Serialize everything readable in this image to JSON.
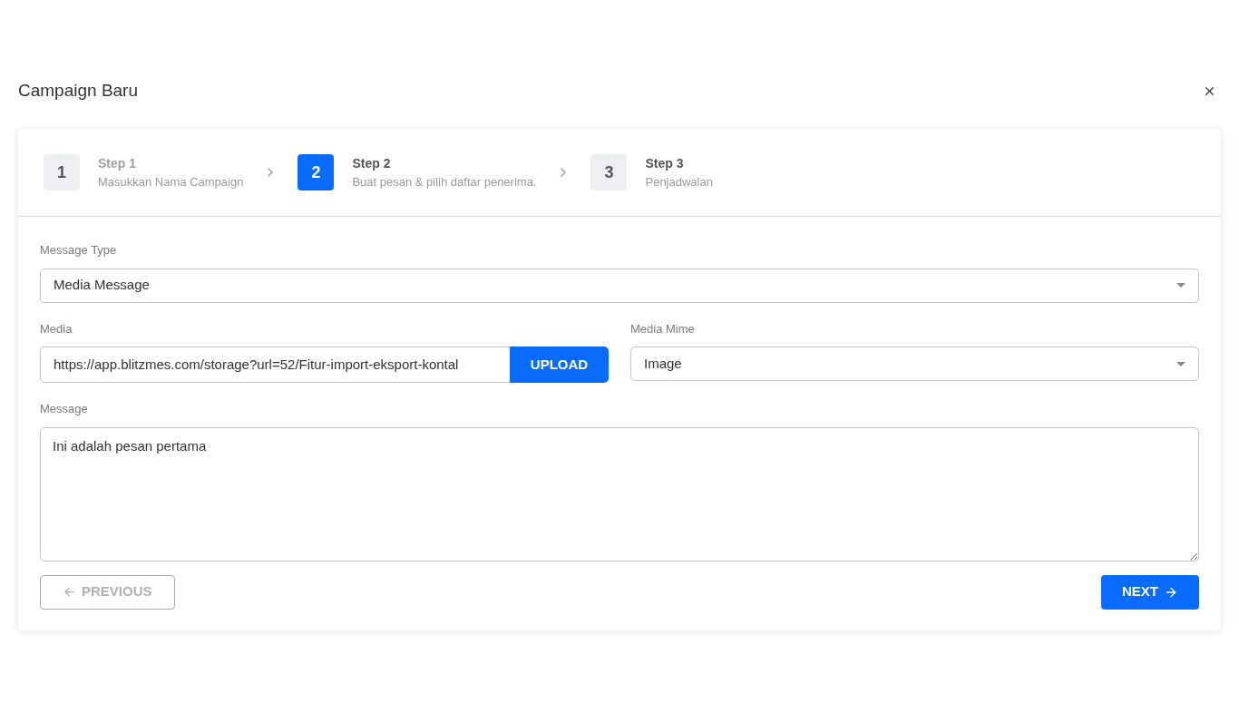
{
  "dialog": {
    "title": "Campaign Baru"
  },
  "steps": [
    {
      "number": "1",
      "title": "Step 1",
      "subtitle": "Masukkan Nama Campaign",
      "selected": false,
      "completed": true
    },
    {
      "number": "2",
      "title": "Step 2",
      "subtitle": "Buat pesan & pilih daftar penerima.",
      "selected": true,
      "completed": false
    },
    {
      "number": "3",
      "title": "Step 3",
      "subtitle": "Penjadwalan",
      "selected": false,
      "completed": false
    }
  ],
  "message_type": {
    "label": "Message Type",
    "value": "Media Message"
  },
  "media": {
    "label": "Media",
    "value": "https://app.blitzmes.com/storage?url=52/Fitur-import-eksport-kontal",
    "button": "UPLOAD"
  },
  "media_mime": {
    "label": "Media Mime",
    "value": "Image"
  },
  "message": {
    "label": "Message",
    "value": "Ini adalah pesan pertama"
  },
  "previous_button": {
    "label": "PREVIOUS",
    "disabled": true
  },
  "next_button": {
    "label": "NEXT",
    "disabled": false
  }
}
